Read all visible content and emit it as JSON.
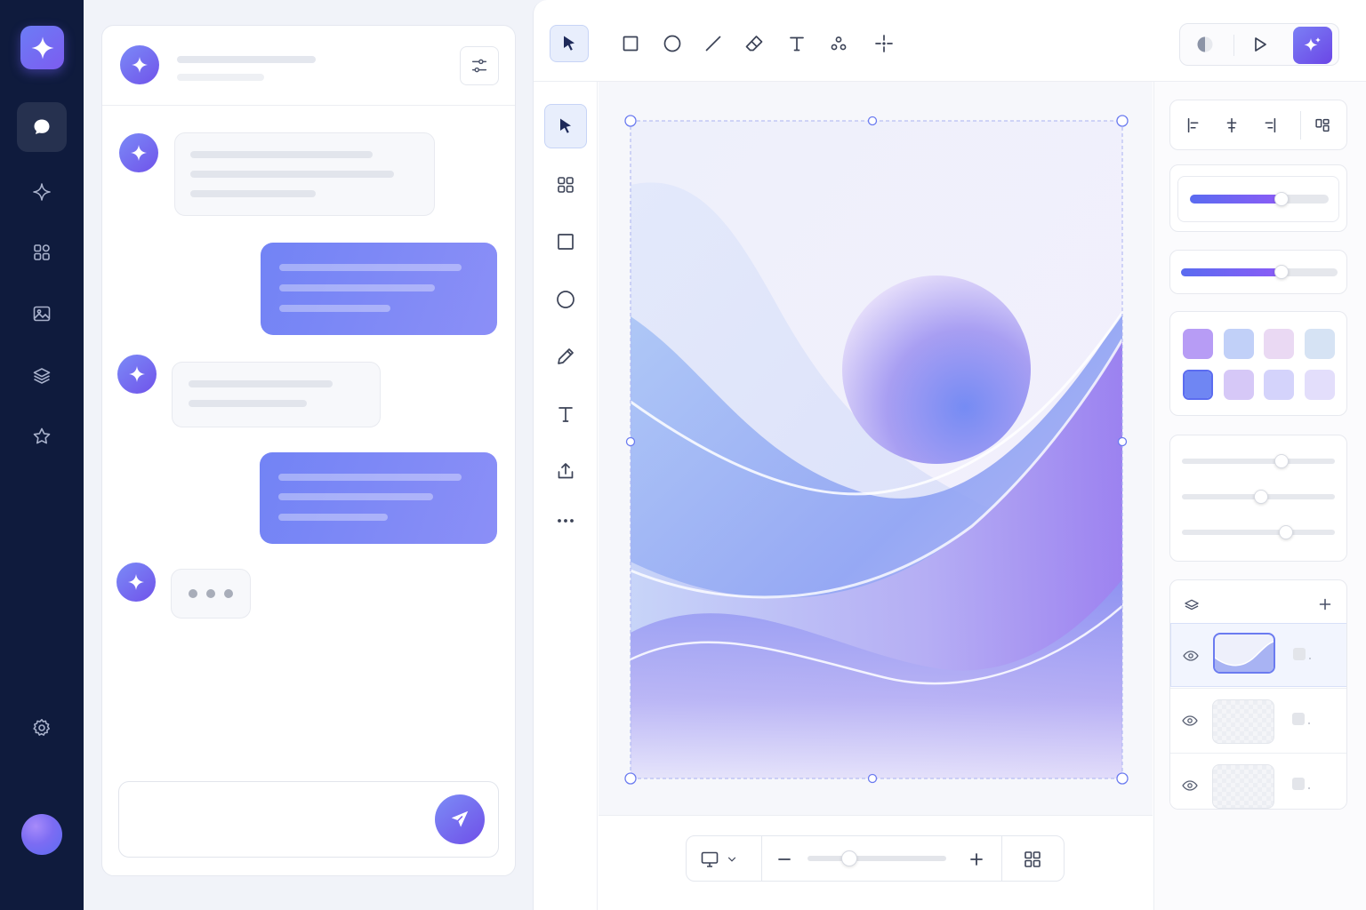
{
  "app": {
    "brand_icon": "sparkle-icon",
    "accent": "#6c5cf0",
    "rail_bg": "#0f1b3d"
  },
  "rail": {
    "items": [
      {
        "name": "chat",
        "icon": "chat-bubble-icon",
        "active": true
      },
      {
        "name": "ai",
        "icon": "sparkle-outline-icon",
        "active": false
      },
      {
        "name": "components",
        "icon": "grid-icon",
        "active": false
      },
      {
        "name": "images",
        "icon": "image-icon",
        "active": false
      },
      {
        "name": "layers",
        "icon": "layers-icon",
        "active": false
      },
      {
        "name": "favorites",
        "icon": "star-icon",
        "active": false
      }
    ],
    "settings_icon": "gear-icon",
    "avatar": "user-avatar"
  },
  "chat": {
    "header": {
      "avatar_icon": "sparkle-icon",
      "filter_icon": "sliders-icon"
    },
    "messages": [
      {
        "from": "ai",
        "lines": 3
      },
      {
        "from": "user",
        "lines": 3
      },
      {
        "from": "ai",
        "lines": 2
      },
      {
        "from": "user",
        "lines": 3
      },
      {
        "from": "ai",
        "typing": true
      }
    ],
    "input": {
      "placeholder": "",
      "send_icon": "send-icon"
    }
  },
  "toolbar": {
    "tools": [
      "select-icon",
      "rectangle-icon",
      "ellipse-icon",
      "line-icon",
      "eraser-icon",
      "text-icon",
      "nodes-icon",
      "crosshair-icon"
    ],
    "active_tool": "select-icon",
    "right": [
      "contrast-icon",
      "play-icon",
      "ai-magic-icon"
    ]
  },
  "side_tools": {
    "tools": [
      "pointer-icon",
      "grid-icon",
      "square-icon",
      "circle-icon",
      "pencil-icon",
      "text-icon",
      "upload-icon",
      "more-icon"
    ],
    "active_tool": "pointer-icon"
  },
  "canvas": {
    "artwork": "abstract-waves-with-sphere",
    "colors": {
      "lavender": "#c9c3f6",
      "blue": "#7b8df4",
      "violet": "#9b7ef0",
      "sky": "#b5c9f7"
    }
  },
  "bottom_bar": {
    "device_icon": "monitor-icon",
    "zoom_out_icon": "minus-icon",
    "zoom_in_icon": "plus-icon",
    "zoom_level": 0.3,
    "grid_icon": "grid-icon"
  },
  "properties": {
    "align_icons": [
      "align-left-icon",
      "align-center-icon",
      "align-right-icon",
      "distribute-icon"
    ],
    "slider_primary": 0.66,
    "slider_secondary": 0.64,
    "swatches": [
      {
        "color": "#b79cf5"
      },
      {
        "color": "#c1d0f8"
      },
      {
        "color": "#ead9f3"
      },
      {
        "color": "#d6e3f4"
      },
      {
        "color": "#6f86f3",
        "selected": true
      },
      {
        "color": "#d6c8f7"
      },
      {
        "color": "#d4d3fb"
      },
      {
        "color": "#e3defb"
      }
    ],
    "fine_sliders": [
      0.65,
      0.52,
      0.68
    ],
    "layers": {
      "header_icon": "layers-icon",
      "add_icon": "plus-icon",
      "rows": [
        {
          "visible": true,
          "selected": true,
          "thumb": "wave-thumb"
        },
        {
          "visible": true,
          "selected": false,
          "thumb": "transparent-thumb"
        },
        {
          "visible": true,
          "selected": false,
          "thumb": "transparent-thumb"
        }
      ]
    }
  }
}
